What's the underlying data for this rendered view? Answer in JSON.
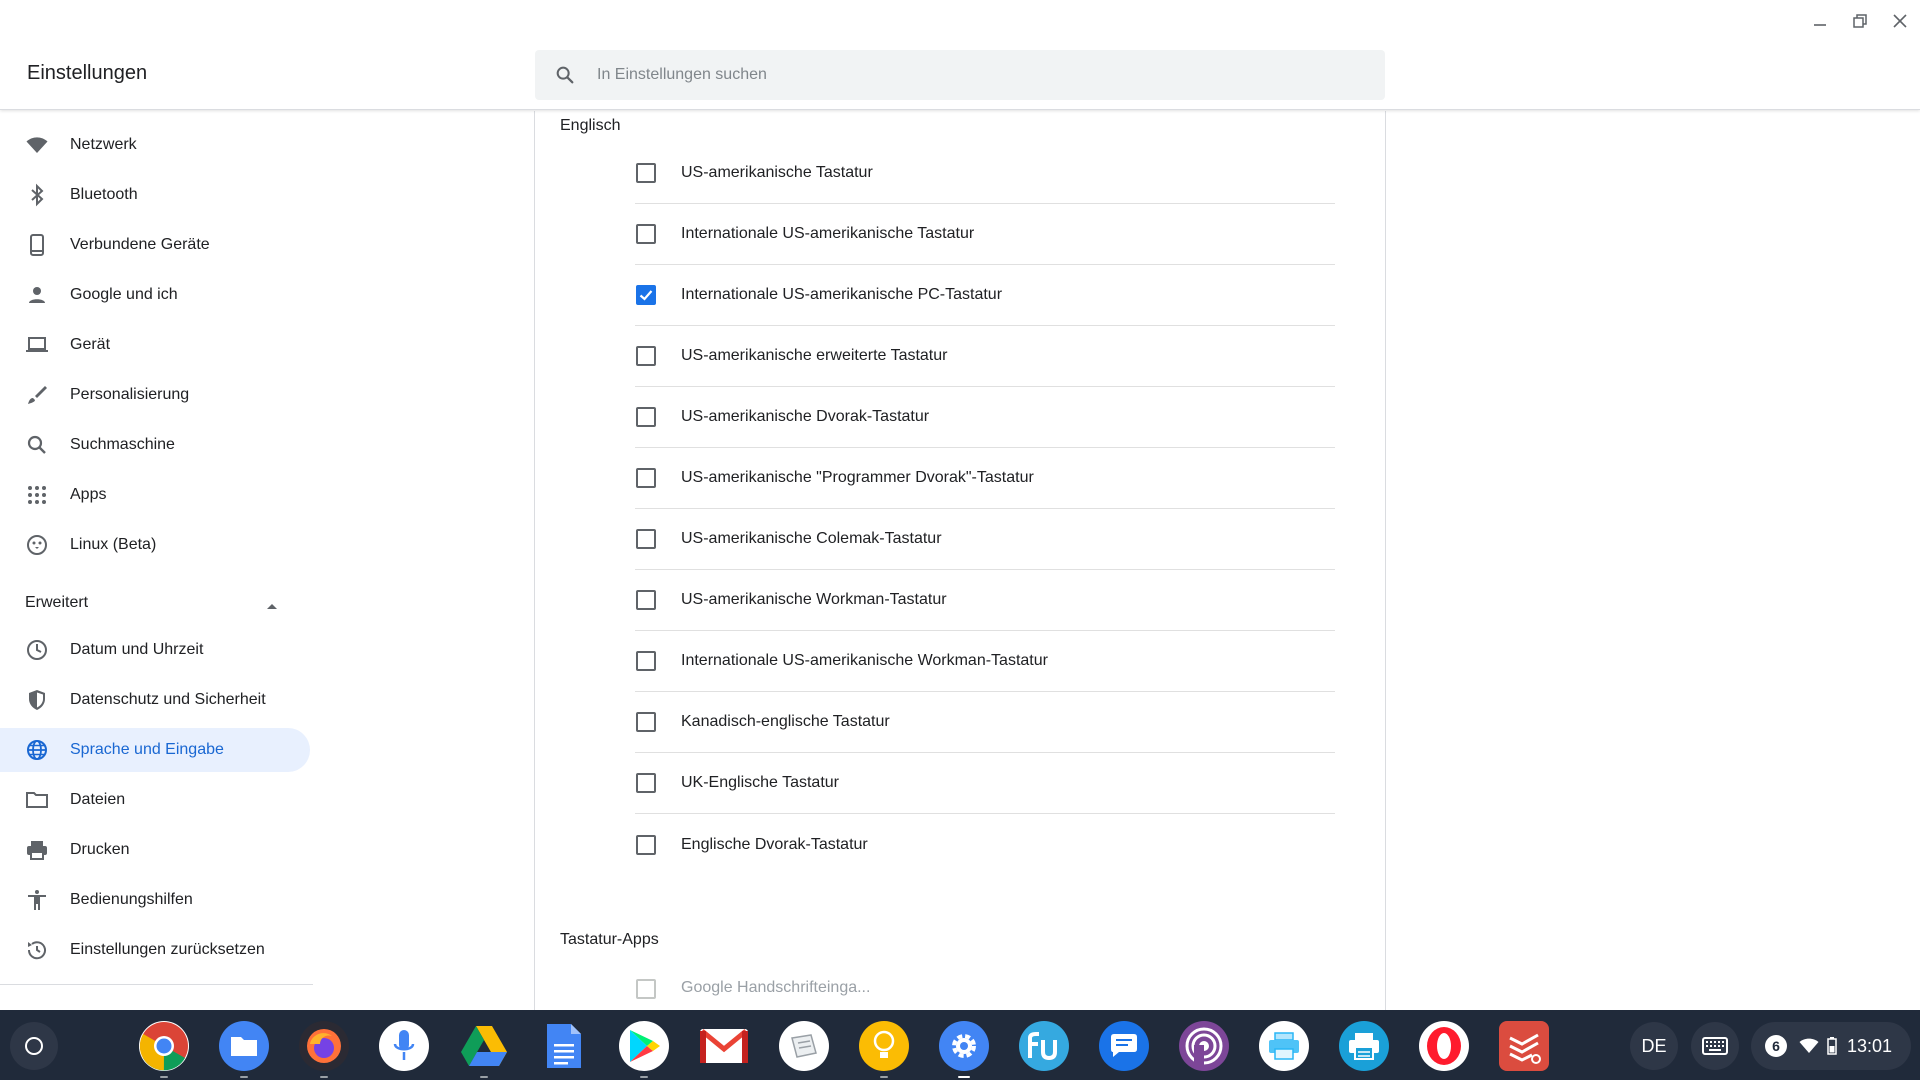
{
  "header": {
    "title": "Einstellungen",
    "search_placeholder": "In Einstellungen suchen"
  },
  "sidebar": {
    "items": [
      {
        "label": "Netzwerk",
        "icon": "wifi-icon"
      },
      {
        "label": "Bluetooth",
        "icon": "bluetooth-icon"
      },
      {
        "label": "Verbundene Geräte",
        "icon": "phone-icon"
      },
      {
        "label": "Google und ich",
        "icon": "person-icon"
      },
      {
        "label": "Gerät",
        "icon": "laptop-icon"
      },
      {
        "label": "Personalisierung",
        "icon": "brush-icon"
      },
      {
        "label": "Suchmaschine",
        "icon": "search-icon"
      },
      {
        "label": "Apps",
        "icon": "apps-grid-icon"
      },
      {
        "label": "Linux (Beta)",
        "icon": "penguin-icon"
      }
    ],
    "advanced_label": "Erweitert",
    "advanced_items": [
      {
        "label": "Datum und Uhrzeit",
        "icon": "clock-icon"
      },
      {
        "label": "Datenschutz und Sicherheit",
        "icon": "shield-icon"
      },
      {
        "label": "Sprache und Eingabe",
        "icon": "globe-icon",
        "active": true
      },
      {
        "label": "Dateien",
        "icon": "folder-icon"
      },
      {
        "label": "Drucken",
        "icon": "printer-icon"
      },
      {
        "label": "Bedienungshilfen",
        "icon": "accessibility-icon"
      },
      {
        "label": "Einstellungen zurücksetzen",
        "icon": "reset-icon"
      }
    ]
  },
  "main": {
    "section_label": "Englisch",
    "keyboards": [
      {
        "label": "US-amerikanische Tastatur",
        "checked": false
      },
      {
        "label": "Internationale US-amerikanische Tastatur",
        "checked": false
      },
      {
        "label": "Internationale US-amerikanische PC-Tastatur",
        "checked": true
      },
      {
        "label": "US-amerikanische erweiterte Tastatur",
        "checked": false
      },
      {
        "label": "US-amerikanische Dvorak-Tastatur",
        "checked": false
      },
      {
        "label": "US-amerikanische \"Programmer Dvorak\"-Tastatur",
        "checked": false
      },
      {
        "label": "US-amerikanische Colemak-Tastatur",
        "checked": false
      },
      {
        "label": "US-amerikanische Workman-Tastatur",
        "checked": false
      },
      {
        "label": "Internationale US-amerikanische Workman-Tastatur",
        "checked": false
      },
      {
        "label": "Kanadisch-englische Tastatur",
        "checked": false
      },
      {
        "label": "UK-Englische Tastatur",
        "checked": false
      },
      {
        "label": "Englische Dvorak-Tastatur",
        "checked": false
      }
    ],
    "apps_section_label": "Tastatur-Apps",
    "apps": [
      {
        "label": "Google Handschrifteinga...",
        "checked": false,
        "disabled": true
      }
    ]
  },
  "shelf": {
    "apps": [
      {
        "name": "chrome-app-icon",
        "color": "#ffffff"
      },
      {
        "name": "files-app-icon",
        "color": "#4285f4"
      },
      {
        "name": "firefox-app-icon",
        "color": "#2b2a33"
      },
      {
        "name": "assistant-mic-app-icon",
        "color": "#ffffff"
      },
      {
        "name": "drive-app-icon",
        "color": "#202a3a"
      },
      {
        "name": "docs-app-icon",
        "color": "#202a3a"
      },
      {
        "name": "play-store-app-icon",
        "color": "#ffffff"
      },
      {
        "name": "gmail-app-icon",
        "color": "#202a3a"
      },
      {
        "name": "notes-app-icon",
        "color": "#ffffff"
      },
      {
        "name": "keep-app-icon",
        "color": "#fbbc04"
      },
      {
        "name": "settings-app-icon",
        "color": "#4285f4"
      },
      {
        "name": "fu-app-icon",
        "color": "#35a9e0"
      },
      {
        "name": "messages-app-icon",
        "color": "#1a73e8"
      },
      {
        "name": "tor-app-icon",
        "color": "#7d4698"
      },
      {
        "name": "print-app-icon",
        "color": "#ffffff"
      },
      {
        "name": "printer-app-icon",
        "color": "#1aa0d8"
      },
      {
        "name": "opera-app-icon",
        "color": "#ffffff"
      },
      {
        "name": "todoist-app-icon",
        "color": "#db4c3f"
      }
    ],
    "ime_label": "DE",
    "notification_count": "6",
    "time": "13:01"
  },
  "colors": {
    "accent": "#1a73e8",
    "active_nav_bg": "#e8f0fe",
    "active_nav_text": "#1967d2",
    "shelf_bg": "#202a3a"
  }
}
